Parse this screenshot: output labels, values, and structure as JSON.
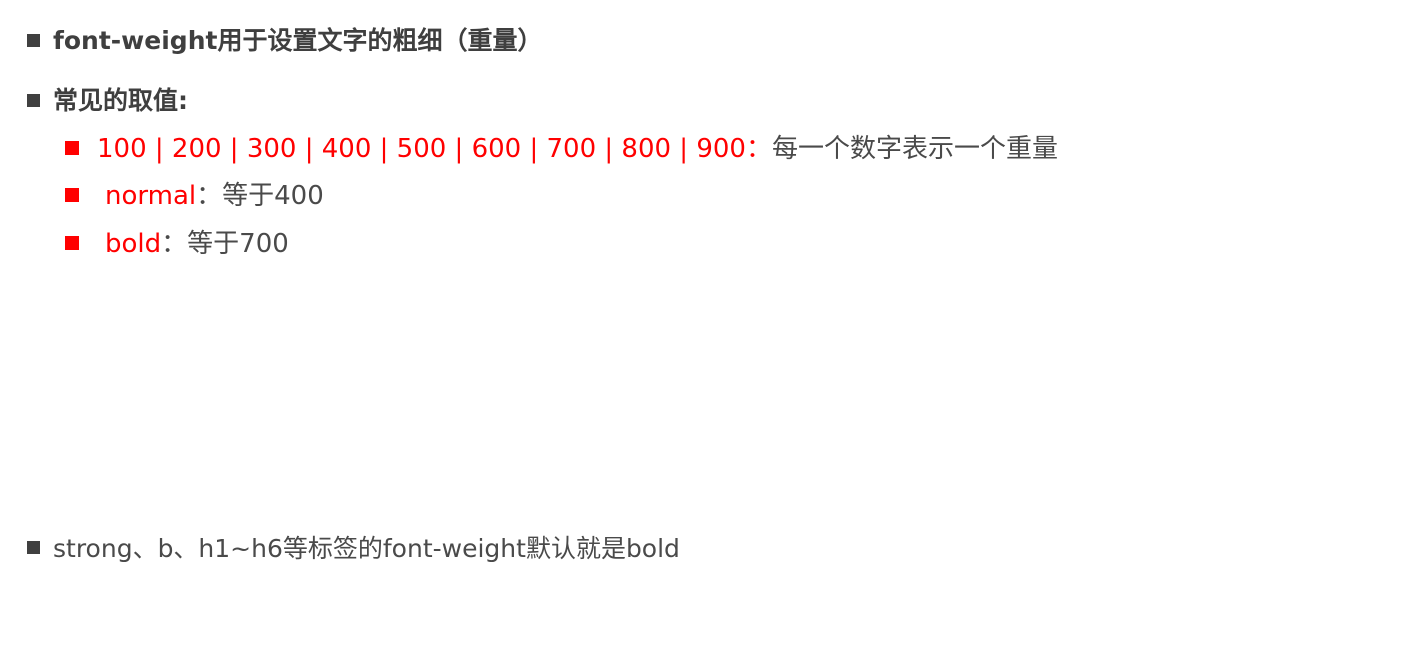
{
  "colors": {
    "accent_red": "#ff0000",
    "text_dark": "#404040",
    "text_gray": "#4a4a4a"
  },
  "items": [
    {
      "text": "font-weight用于设置文字的粗细（重量）"
    },
    {
      "text": "常见的取值:",
      "subitems": [
        {
          "value": "100 | 200 | 300 | 400 | 500 | 600 | 700 | 800 | 900",
          "separator": "：",
          "desc": "每一个数字表示一个重量"
        },
        {
          "value": "normal",
          "separator": "：",
          "desc": "等于400"
        },
        {
          "value": "bold",
          "separator": "：",
          "desc": "等于700"
        }
      ]
    },
    {
      "text": "strong、b、h1~h6等标签的font-weight默认就是bold"
    }
  ]
}
